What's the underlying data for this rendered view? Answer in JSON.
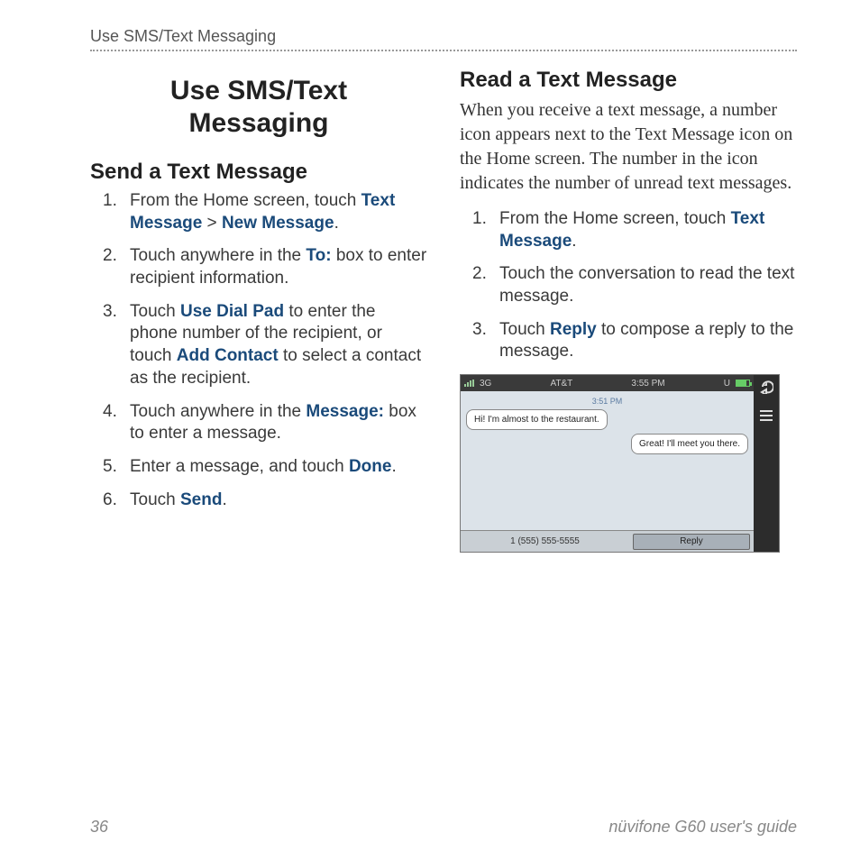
{
  "header": "Use SMS/Text Messaging",
  "main_title_l1": "Use SMS/Text",
  "main_title_l2": "Messaging",
  "left": {
    "heading": "Send a Text Message",
    "steps": [
      {
        "n": "1.",
        "pre": "From the Home screen, touch ",
        "kw1": "Text Message",
        "mid": " > ",
        "kw2": "New Message",
        "post": "."
      },
      {
        "n": "2.",
        "pre": "Touch anywhere in the ",
        "kw1": "To:",
        "mid": "",
        "kw2": "",
        "post": " box to enter recipient information."
      },
      {
        "n": "3.",
        "pre": "Touch ",
        "kw1": "Use Dial Pad",
        "mid": " to enter the phone number of the recipient, or touch ",
        "kw2": "Add Contact",
        "post": " to select a contact as the recipient."
      },
      {
        "n": "4.",
        "pre": "Touch anywhere in the ",
        "kw1": "Message:",
        "mid": "",
        "kw2": "",
        "post": " box to enter a message."
      },
      {
        "n": "5.",
        "pre": "Enter a message, and touch ",
        "kw1": "Done",
        "mid": "",
        "kw2": "",
        "post": "."
      },
      {
        "n": "6.",
        "pre": "Touch ",
        "kw1": "Send",
        "mid": "",
        "kw2": "",
        "post": "."
      }
    ]
  },
  "right": {
    "heading": "Read a Text Message",
    "intro": "When you receive a text message, a number icon appears next to the Text Message icon on the Home screen. The number in the icon indicates the number of unread text messages.",
    "steps": [
      {
        "n": "1.",
        "pre": "From the Home screen, touch ",
        "kw1": "Text Message",
        "post": "."
      },
      {
        "n": "2.",
        "pre": "Touch the conversation to read the text message.",
        "kw1": "",
        "post": ""
      },
      {
        "n": "3.",
        "pre": "Touch ",
        "kw1": "Reply",
        "post": " to compose a reply to the message."
      }
    ]
  },
  "phone": {
    "signal": "3G",
    "carrier": "AT&T",
    "time": "3:55 PM",
    "usb": "U",
    "ts": "3:51 PM",
    "msg1": "Hi! I'm almost to the restaurant.",
    "msg2": "Great! I'll meet you there.",
    "number": "1 (555) 555-5555",
    "reply": "Reply"
  },
  "footer": {
    "page": "36",
    "guide": "nüvifone G60 user's guide"
  }
}
